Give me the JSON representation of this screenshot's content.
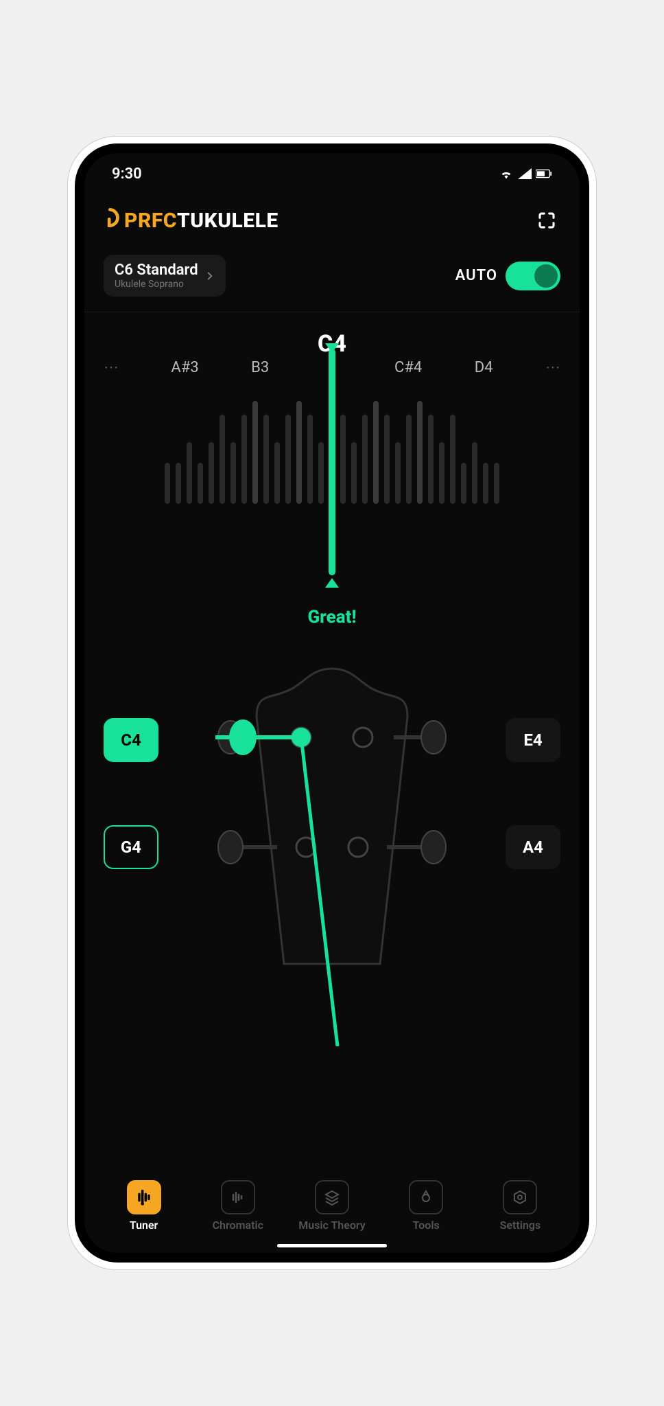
{
  "status": {
    "time": "9:30"
  },
  "logo": {
    "prefix": "PRFC",
    "rest": "TUKULELE"
  },
  "tuning": {
    "name": "C6 Standard",
    "sub": "Ukulele Soprano"
  },
  "auto": {
    "label": "AUTO"
  },
  "meter": {
    "current_note": "C4",
    "scale": {
      "far_left": "A#3",
      "left": "B3",
      "right": "C#4",
      "far_right": "D4"
    },
    "feedback": "Great!"
  },
  "strings": {
    "c4": "C4",
    "g4": "G4",
    "e4": "E4",
    "a4": "A4"
  },
  "nav": {
    "tuner": "Tuner",
    "chromatic": "Chromatic",
    "theory": "Music Theory",
    "tools": "Tools",
    "settings": "Settings"
  },
  "colors": {
    "accent": "#18e299",
    "brand_orange": "#F5A623"
  }
}
